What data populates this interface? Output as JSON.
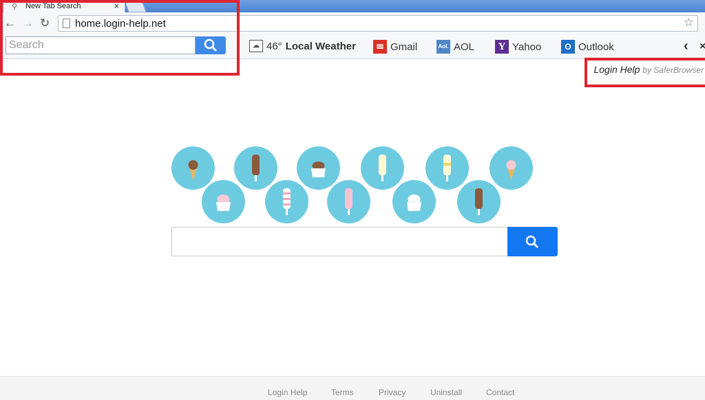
{
  "browser": {
    "tab_title": "New Tab Search",
    "url": "home.login-help.net"
  },
  "ext_toolbar": {
    "search_placeholder": "Search",
    "weather_temp": "46°",
    "weather_label": "Local Weather",
    "links": {
      "gmail": "Gmail",
      "aol_icon_text": "Aol.",
      "aol": "AOL",
      "yahoo_icon_text": "Y",
      "yahoo": "Yahoo",
      "outlook_icon_text": "O",
      "outlook": "Outlook"
    }
  },
  "brand": {
    "name": "Login Help",
    "by": "by SaferBrowser"
  },
  "footer": {
    "links": [
      "Login Help",
      "Terms",
      "Privacy",
      "Uninstall",
      "Contact"
    ]
  },
  "colors": {
    "circle": "#6ccbe0",
    "search_button": "#1477f2",
    "highlight": "#e0242f"
  }
}
